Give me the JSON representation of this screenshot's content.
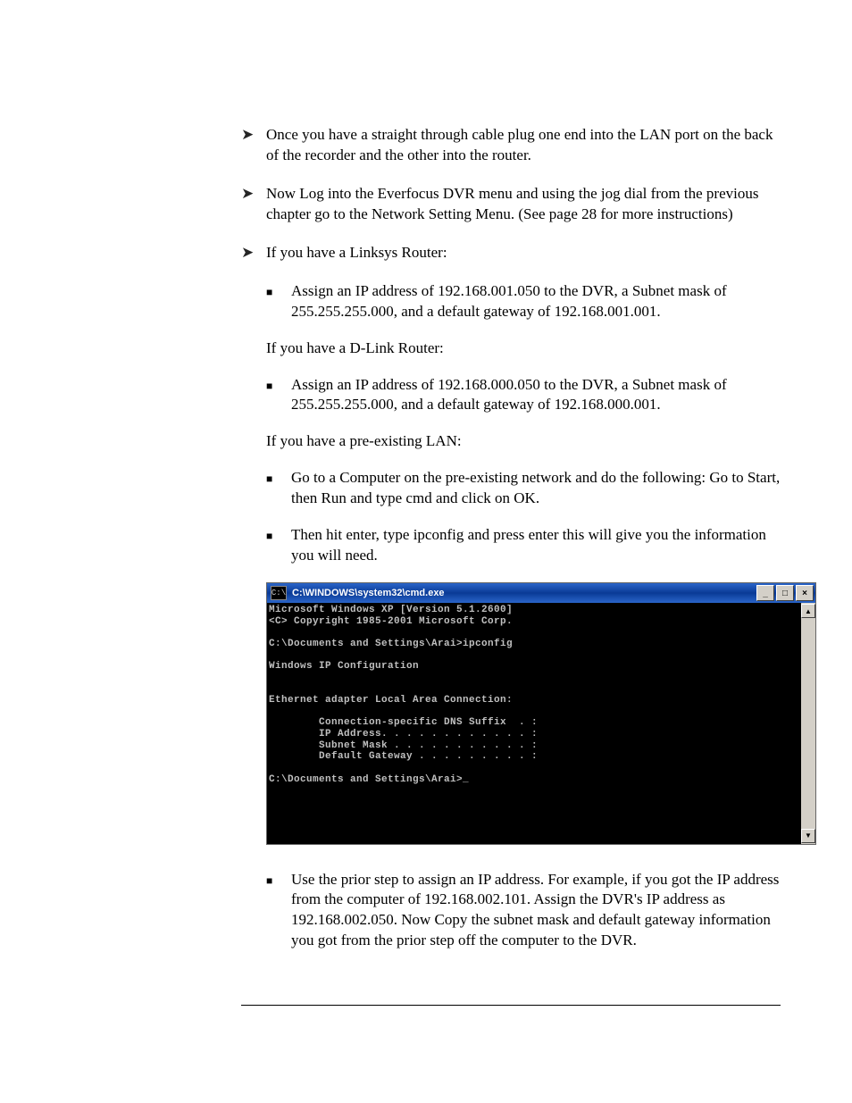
{
  "bullets": {
    "b1": "Once you have a straight through cable plug one end into the LAN port on the back of the recorder and the other into the router.",
    "b2": "Now Log into the Everfocus DVR menu and using the jog dial from the previous chapter go to the Network Setting Menu. (See page 28 for more instructions)",
    "b3": "If you have a Linksys Router:"
  },
  "subs": {
    "linksys": "Assign an IP address of 192.168.001.050 to the DVR, a Subnet mask of 255.255.255.000, and a default gateway of 192.168.001.001.",
    "dlink_header": "If you have a D-Link Router:",
    "dlink": "Assign an IP address of 192.168.000.050 to the DVR, a Subnet mask of 255.255.255.000, and a default gateway of 192.168.000.001.",
    "lan_header": "If you have a pre-existing LAN:",
    "lan1": "Go to a Computer on the pre-existing network and do the following: Go to Start, then Run and type cmd and click on OK.",
    "lan2": "Then hit enter, type ipconfig and press enter this will give you the information you will need.",
    "lan3": "Use the prior step to assign an IP address. For example, if you got the IP address from the computer of 192.168.002.101. Assign the DVR's IP address as 192.168.002.050. Now Copy the subnet mask and default gateway information you got from the prior step off the computer to the DVR."
  },
  "cmd": {
    "title": "C:\\WINDOWS\\system32\\cmd.exe",
    "icon_text": "C:\\",
    "min": "_",
    "max": "□",
    "close": "×",
    "scroll_up": "▲",
    "scroll_down": "▼",
    "body": "Microsoft Windows XP [Version 5.1.2600]\n<C> Copyright 1985-2001 Microsoft Corp.\n\nC:\\Documents and Settings\\Arai>ipconfig\n\nWindows IP Configuration\n\n\nEthernet adapter Local Area Connection:\n\n        Connection-specific DNS Suffix  . :\n        IP Address. . . . . . . . . . . . :\n        Subnet Mask . . . . . . . . . . . :\n        Default Gateway . . . . . . . . . :\n\nC:\\Documents and Settings\\Arai>_\n\n\n\n\n\n"
  }
}
